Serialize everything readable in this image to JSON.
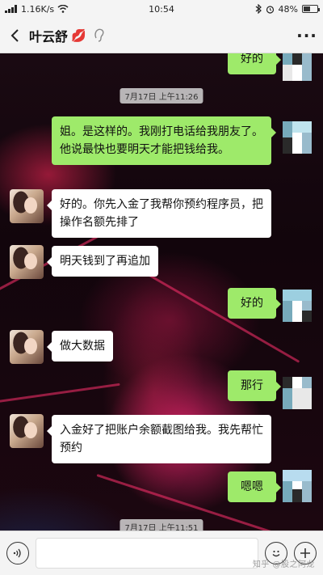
{
  "status_bar": {
    "network": "1.16K/s",
    "time": "10:54",
    "battery": "48%",
    "battery_level": 0.48
  },
  "header": {
    "contact_name": "叶云舒",
    "name_emoji": "💋"
  },
  "chat": {
    "top_partial_message": "好的",
    "timestamps": [
      "7月17日 上午11:26",
      "7月17日 上午11:51"
    ],
    "messages": [
      {
        "side": "out",
        "text": "姐。是这样的。我刚打电话给我朋友了。他说最快也要明天才能把钱给我。"
      },
      {
        "side": "in",
        "text": "好的。你先入金了我帮你预约程序员，把操作名额先排了"
      },
      {
        "side": "in",
        "text": "明天钱到了再追加"
      },
      {
        "side": "out",
        "text": "好的"
      },
      {
        "side": "in",
        "text": "做大数据"
      },
      {
        "side": "out",
        "text": "那行"
      },
      {
        "side": "in",
        "text": "入金好了把账户余额截图给我。我先帮忙预约"
      },
      {
        "side": "out",
        "text": "嗯嗯"
      }
    ]
  },
  "input_bar": {
    "value": "",
    "placeholder": ""
  },
  "watermark": "知乎 @股之阿龙",
  "colors": {
    "outgoing_bubble": "#9eea6a",
    "incoming_bubble": "#ffffff",
    "accent_lips": "#d1162e"
  },
  "icons": [
    "back-arrow-icon",
    "ear-icon",
    "more-icon",
    "voice-icon",
    "emoji-icon",
    "plus-icon",
    "wifi-icon",
    "bluetooth-icon",
    "alarm-icon",
    "signal-icon",
    "battery-icon"
  ]
}
